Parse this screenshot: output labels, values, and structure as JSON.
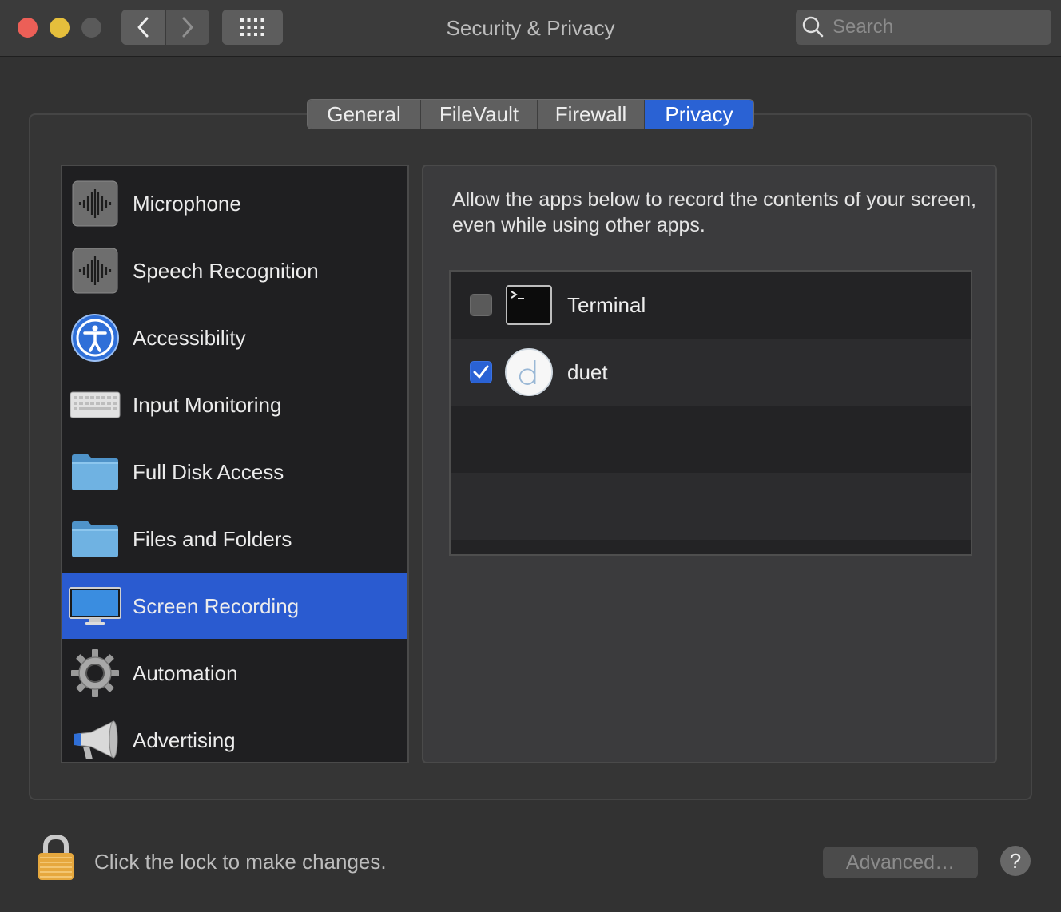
{
  "window": {
    "title": "Security & Privacy",
    "search_placeholder": "Search"
  },
  "tabs": [
    {
      "label": "General",
      "active": false
    },
    {
      "label": "FileVault",
      "active": false
    },
    {
      "label": "Firewall",
      "active": false
    },
    {
      "label": "Privacy",
      "active": true
    }
  ],
  "sidebar": {
    "selected": "Screen Recording",
    "items": [
      {
        "label": "Microphone",
        "icon": "microphone-icon"
      },
      {
        "label": "Speech Recognition",
        "icon": "speech-recognition-icon"
      },
      {
        "label": "Accessibility",
        "icon": "accessibility-icon"
      },
      {
        "label": "Input Monitoring",
        "icon": "keyboard-icon"
      },
      {
        "label": "Full Disk Access",
        "icon": "folder-icon"
      },
      {
        "label": "Files and Folders",
        "icon": "folder-icon"
      },
      {
        "label": "Screen Recording",
        "icon": "display-icon"
      },
      {
        "label": "Automation",
        "icon": "gear-icon"
      },
      {
        "label": "Advertising",
        "icon": "megaphone-icon"
      }
    ]
  },
  "panel": {
    "description": "Allow the apps below to record the contents of your screen, even while using other apps.",
    "apps": [
      {
        "name": "Terminal",
        "checked": false,
        "icon": "terminal-icon"
      },
      {
        "name": "duet",
        "checked": true,
        "icon": "duet-icon"
      }
    ]
  },
  "footer": {
    "lock_text": "Click the lock to make changes.",
    "advanced_label": "Advanced…",
    "help_label": "?"
  },
  "colors": {
    "accent": "#2a62d4",
    "close": "#ec5f57",
    "minimize": "#e5bf3c"
  }
}
